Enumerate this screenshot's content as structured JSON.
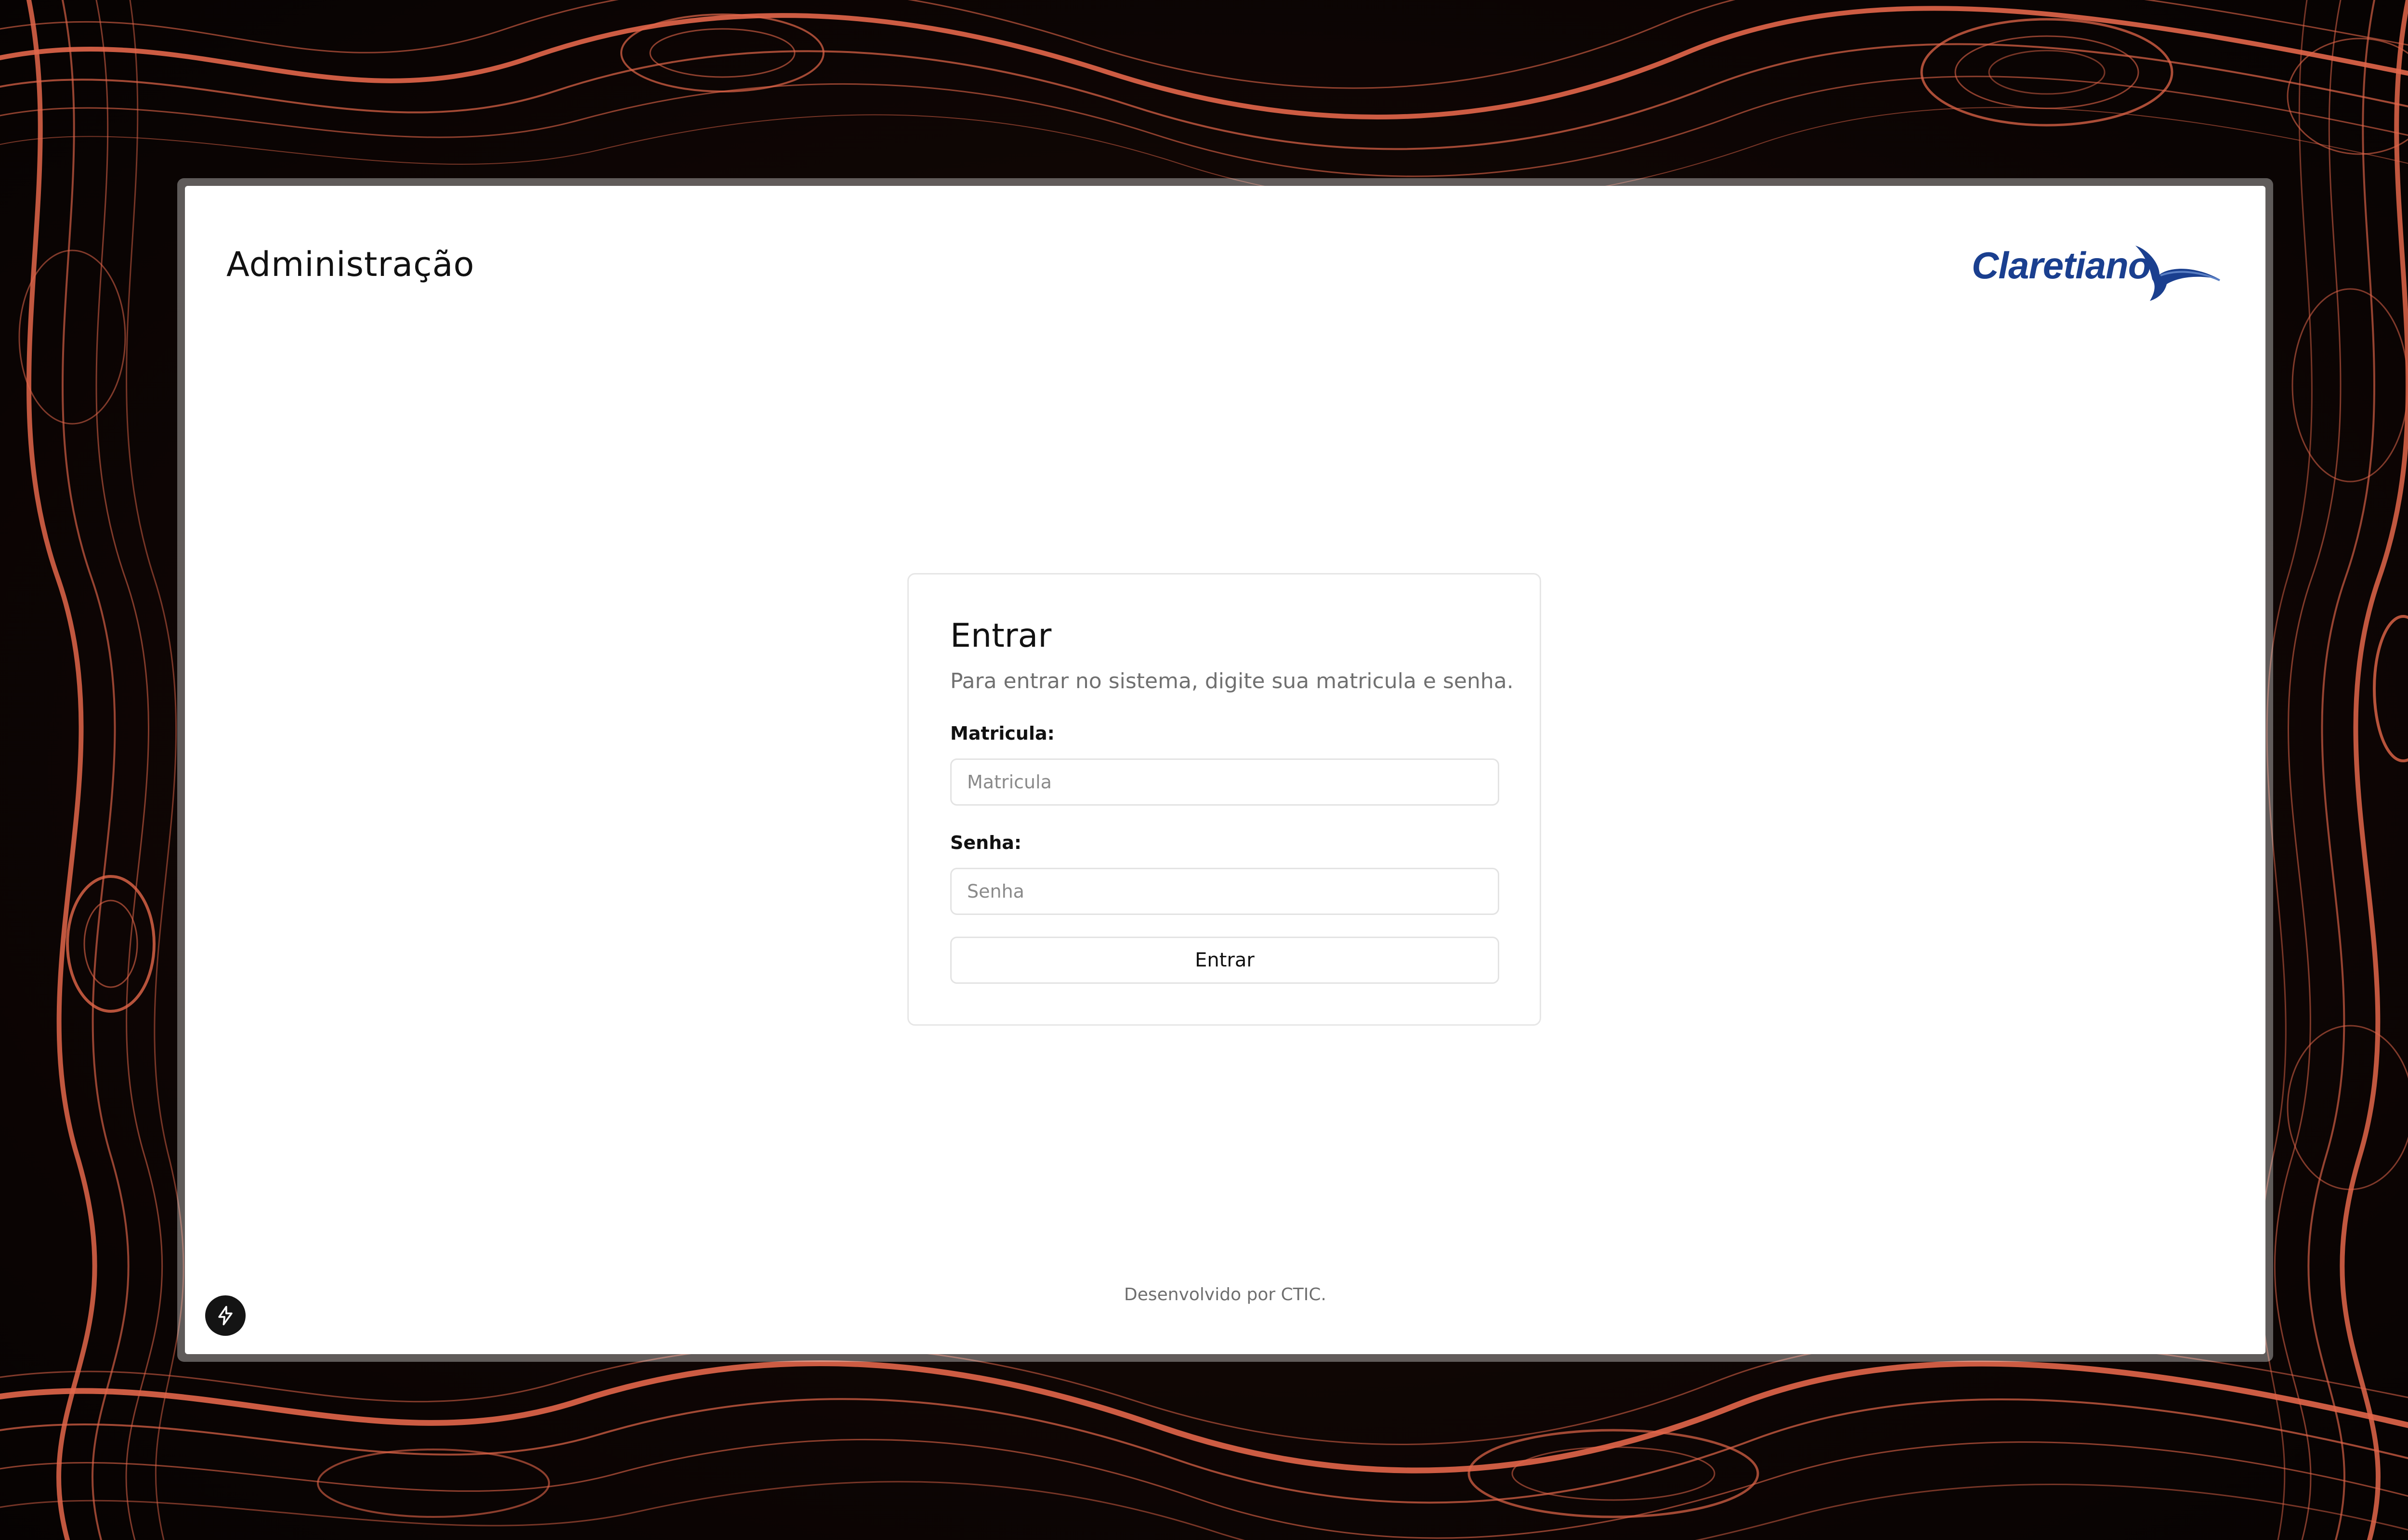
{
  "header": {
    "title": "Administração",
    "logo_text": "Claretiano",
    "logo_color": "#1a3f8f"
  },
  "login": {
    "title": "Entrar",
    "description": "Para entrar no sistema, digite sua matricula e senha.",
    "matricula_label": "Matricula:",
    "matricula_placeholder": "Matricula",
    "matricula_value": "",
    "senha_label": "Senha:",
    "senha_placeholder": "Senha",
    "senha_value": "",
    "submit_label": "Entrar"
  },
  "footer": {
    "text": "Desenvolvido por CTIC."
  },
  "dev_badge": {
    "icon": "lightning-bolt-icon"
  },
  "background": {
    "theme": "topographic contour lines",
    "line_color": "#e2664a",
    "base_color": "#0b0504"
  }
}
